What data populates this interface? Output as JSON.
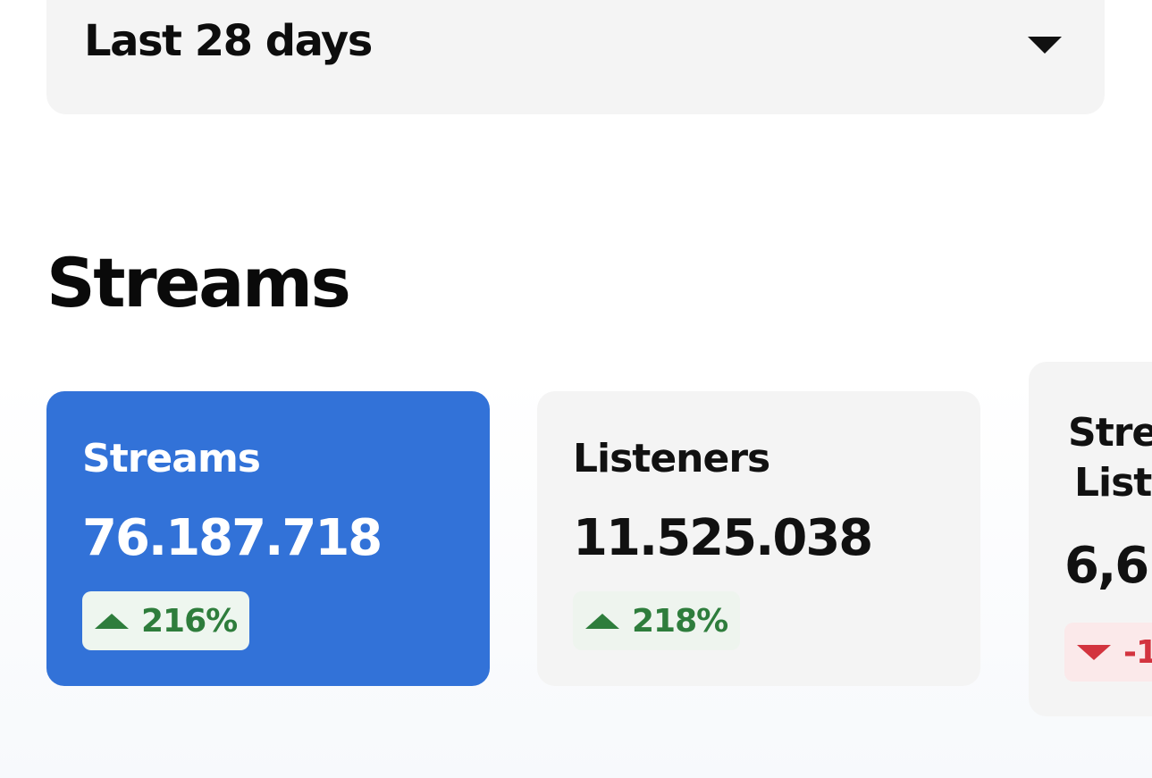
{
  "filter": {
    "period_label": "Last 28 days",
    "icon": "caret-down-icon"
  },
  "section": {
    "title": "Streams"
  },
  "cards": [
    {
      "label": "Streams",
      "value": "76.187.718",
      "change": "216%",
      "trend": "up",
      "selected": true
    },
    {
      "label": "Listeners",
      "value": "11.525.038",
      "change": "218%",
      "trend": "up",
      "selected": false
    },
    {
      "label_line1": "Stre",
      "label_line2": "List",
      "value": "6,6",
      "change": "-1",
      "trend": "down",
      "selected": false
    }
  ],
  "colors": {
    "selected_card": "#3272d8",
    "card_bg": "#f4f4f4",
    "positive": "#2e7d3c",
    "negative": "#d3343f"
  }
}
